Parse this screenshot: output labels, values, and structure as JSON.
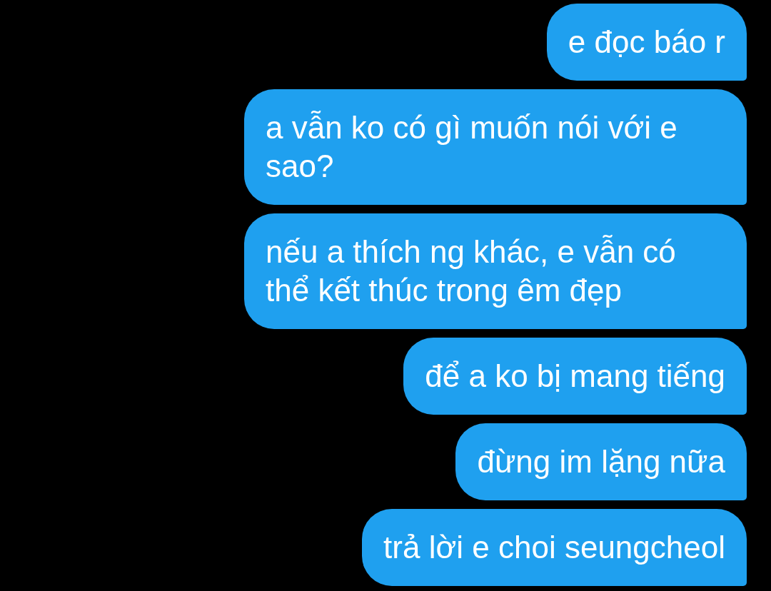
{
  "messages": [
    {
      "text": "e đọc báo r"
    },
    {
      "text": "a vẫn ko có gì muốn nói với e sao?"
    },
    {
      "text": "nếu a thích ng khác, e vẫn có thể kết thúc trong êm đẹp"
    },
    {
      "text": "để a ko bị mang tiếng"
    },
    {
      "text": "đừng im lặng nữa"
    },
    {
      "text": "trả lời e choi seungcheol"
    }
  ]
}
